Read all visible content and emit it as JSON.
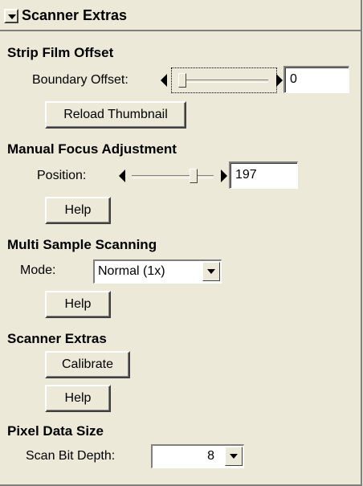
{
  "header": {
    "title": "Scanner Extras"
  },
  "strip_film": {
    "title": "Strip Film Offset",
    "boundary_label": "Boundary Offset:",
    "boundary_value": "0",
    "slider_level": 0.0,
    "reload_label": "Reload Thumbnail"
  },
  "manual_focus": {
    "title": "Manual Focus Adjustment",
    "position_label": "Position:",
    "position_value": "197",
    "slider_level": 0.77,
    "help_label": "Help"
  },
  "multi_sample": {
    "title": "Multi Sample Scanning",
    "mode_label": "Mode:",
    "mode_value": "Normal (1x)",
    "help_label": "Help"
  },
  "scanner_extras": {
    "title": "Scanner Extras",
    "calibrate_label": "Calibrate",
    "help_label": "Help"
  },
  "pixel_data": {
    "title": "Pixel Data Size",
    "depth_label": "Scan Bit Depth:",
    "depth_value": "8"
  },
  "icons": {
    "collapse": "chevron-down-icon",
    "slider_left": "triangle-left-icon",
    "slider_right": "triangle-right-icon",
    "dropdown": "chevron-down-icon"
  }
}
